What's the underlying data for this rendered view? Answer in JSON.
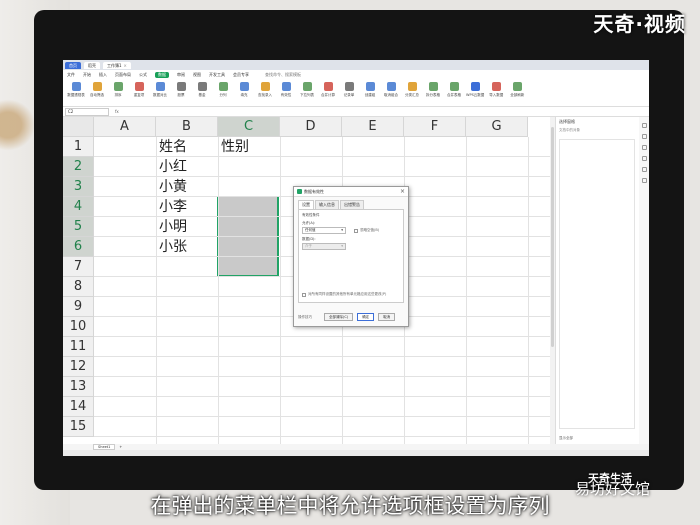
{
  "watermark": "天奇·视频",
  "subtitle": "在弹出的菜单栏中将允许选项框设置为序列",
  "logo_text": "天奇生活",
  "logo_text2": "易坊好文馆",
  "app": {
    "tabs": [
      {
        "label": "首页"
      },
      {
        "label": "稻壳"
      },
      {
        "label": "工作簿1"
      }
    ],
    "menu": [
      "文件",
      "开始",
      "插入",
      "页面布局",
      "公式",
      "数据",
      "审阅",
      "视图",
      "开发工具",
      "会员专享"
    ],
    "active_menu": "数据",
    "search": "查找命令、搜索模板",
    "ribbon": [
      {
        "label": "数据透视表",
        "icon": "pivot-icon",
        "color": "#5b8ad6"
      },
      {
        "label": "自动筛选",
        "icon": "filter-icon",
        "color": "#e0a43a"
      },
      {
        "label": "排序",
        "icon": "sort-icon",
        "color": "#6aa56a"
      },
      {
        "label": "重复项",
        "icon": "duplicate-icon",
        "color": "#d6645b"
      },
      {
        "label": "数据对比",
        "icon": "compare-icon",
        "color": "#5b8ad6"
      },
      {
        "label": "股票",
        "icon": "stock-icon",
        "color": "#7a7a7a"
      },
      {
        "label": "基金",
        "icon": "fund-icon",
        "color": "#7a7a7a"
      },
      {
        "label": "分列",
        "icon": "split-icon",
        "color": "#6aa56a"
      },
      {
        "label": "填充",
        "icon": "fill-icon",
        "color": "#5b8ad6"
      },
      {
        "label": "查找录入",
        "icon": "lookup-icon",
        "color": "#e0a43a"
      },
      {
        "label": "有效性",
        "icon": "validation-icon",
        "color": "#5b8ad6"
      },
      {
        "label": "下拉列表",
        "icon": "dropdown-list-icon",
        "color": "#6aa56a"
      },
      {
        "label": "合并计算",
        "icon": "merge-calc-icon",
        "color": "#d6645b"
      },
      {
        "label": "记录单",
        "icon": "record-icon",
        "color": "#7a7a7a"
      },
      {
        "label": "创建组",
        "icon": "group-icon",
        "color": "#5b8ad6"
      },
      {
        "label": "取消组合",
        "icon": "ungroup-icon",
        "color": "#5b8ad6"
      },
      {
        "label": "分类汇总",
        "icon": "subtotal-icon",
        "color": "#e0a43a"
      },
      {
        "label": "拆分表格",
        "icon": "split-table-icon",
        "color": "#6aa56a"
      },
      {
        "label": "合并表格",
        "icon": "merge-table-icon",
        "color": "#6aa56a"
      },
      {
        "label": "WPS云数据",
        "icon": "cloud-data-icon",
        "color": "#3c6ed8"
      },
      {
        "label": "导入数据",
        "icon": "import-icon",
        "color": "#d6645b"
      },
      {
        "label": "全部刷新",
        "icon": "refresh-icon",
        "color": "#6aa56a"
      }
    ],
    "namebox": "C2",
    "fx": "fx"
  },
  "sheet": {
    "columns": [
      "A",
      "B",
      "C",
      "D",
      "E",
      "F",
      "G"
    ],
    "rows": [
      "1",
      "2",
      "3",
      "4",
      "5",
      "6",
      "7",
      "8",
      "9",
      "10",
      "11",
      "12",
      "13",
      "14",
      "15"
    ],
    "cells": {
      "B1": "姓名",
      "C1": "性别",
      "B2": "小红",
      "B3": "小黄",
      "B4": "小李",
      "B5": "小明",
      "B6": "小张"
    },
    "sheet_tab": "Sheet1"
  },
  "right_pane": {
    "title": "选择窗格",
    "subtitle": "文档中的对象",
    "footer": "显示全部"
  },
  "dialog": {
    "title": "数据有效性",
    "tabs": [
      "设置",
      "输入信息",
      "出错警告"
    ],
    "section": "有效性条件",
    "allow_label": "允许(A):",
    "allow_value": "任何值",
    "ignore_blank": "忽略空值(B)",
    "data_label": "数据(D):",
    "data_value": "介于",
    "apply_all": "对所有同样设置的其他所有单元格应用这些更改(P)",
    "tips": "操作技巧",
    "clear_all": "全部清除(C)",
    "ok": "确定",
    "cancel": "取消"
  }
}
